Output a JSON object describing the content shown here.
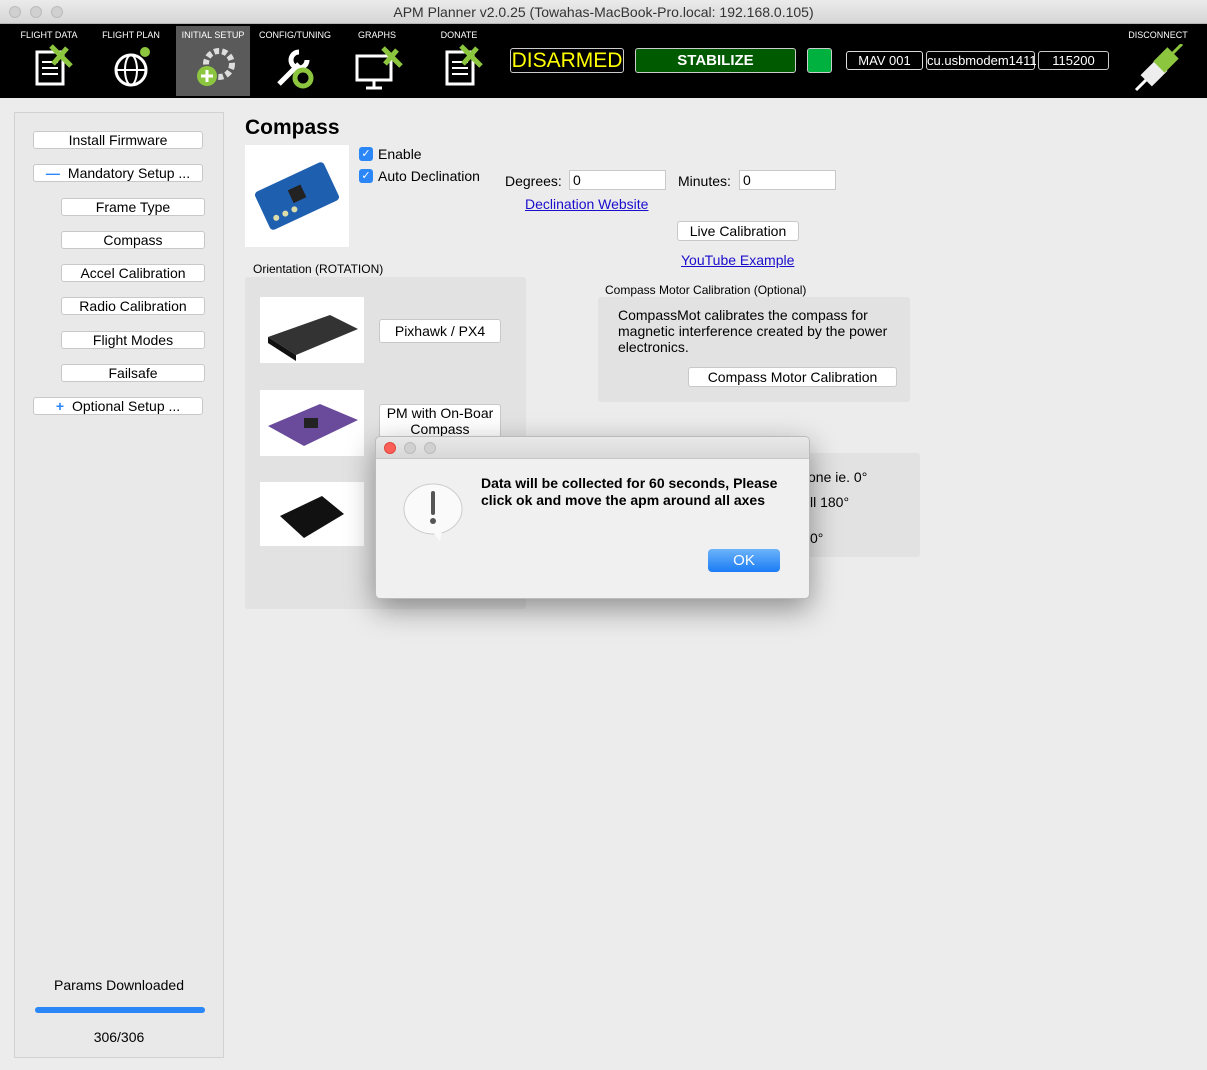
{
  "window": {
    "title": "APM Planner v2.0.25 (Towahas-MacBook-Pro.local: 192.168.0.105)"
  },
  "toolbar": {
    "items": [
      {
        "label": "FLIGHT DATA",
        "icon": "flight-data-icon"
      },
      {
        "label": "FLIGHT PLAN",
        "icon": "flight-plan-icon"
      },
      {
        "label": "INITIAL SETUP",
        "icon": "initial-setup-icon",
        "active": true
      },
      {
        "label": "CONFIG/TUNING",
        "icon": "config-tuning-icon"
      },
      {
        "label": "GRAPHS",
        "icon": "graphs-icon"
      },
      {
        "label": "DONATE",
        "icon": "donate-icon"
      }
    ],
    "arm_state": "DISARMED",
    "mode": "STABILIZE",
    "mav": "MAV 001",
    "port": "cu.usbmodem1411",
    "baud": "115200",
    "disconnect": "DISCONNECT",
    "colors": {
      "armed_text": "#ffff00",
      "mode_bg": "#005a00",
      "heartbeat": "#00b140",
      "accent": "#8cc63f"
    }
  },
  "sidebar": {
    "items": [
      "Install Firmware",
      "Mandatory Setup ...",
      "Frame Type",
      "Compass",
      "Accel Calibration",
      "Radio Calibration",
      "Flight Modes",
      "Failsafe",
      "Optional Setup ..."
    ],
    "params_label": "Params Downloaded",
    "params_progress": 1.0,
    "params_count": "306/306"
  },
  "main": {
    "title": "Compass",
    "enable": "Enable",
    "auto_decl": "Auto Declination",
    "degrees_label": "Degrees:",
    "degrees_value": "0",
    "minutes_label": "Minutes:",
    "minutes_value": "0",
    "decl_link": "Declination Website",
    "live_cal": "Live Calibration",
    "youtube": "YouTube Example",
    "orientation_label": "Orientation (ROTATION)",
    "pixhawk": "Pixhawk / PX4",
    "pm_onboard": "PM with On-Boar Compass",
    "motor_label": "Compass Motor Calibration (Optional)",
    "motor_text": "CompassMot calibrates the compass for magnetic interference created by the power electronics.",
    "motor_btn": "Compass Motor Calibration",
    "hidden_fragments": [
      "one ie. 0°",
      "ll 180°",
      "0°"
    ]
  },
  "dialog": {
    "message": "Data will be collected for 60 seconds, Please click ok and move the apm around all axes",
    "ok": "OK"
  }
}
